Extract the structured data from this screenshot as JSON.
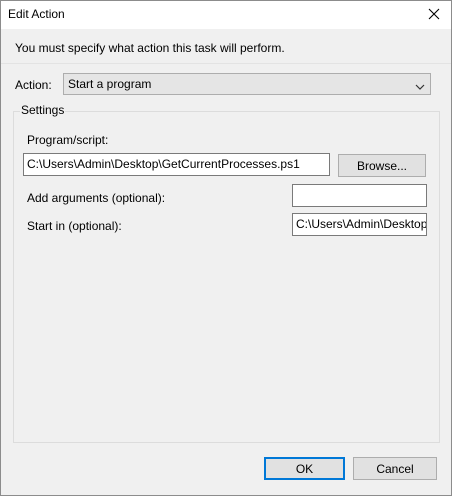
{
  "window": {
    "title": "Edit Action",
    "close_glyph": "✕"
  },
  "instruction": "You must specify what action this task will perform.",
  "action": {
    "label": "Action:",
    "selected": "Start a program"
  },
  "settings": {
    "legend": "Settings",
    "program_label": "Program/script:",
    "program_value": "C:\\Users\\Admin\\Desktop\\GetCurrentProcesses.ps1",
    "browse_label": "Browse...",
    "args_label": "Add arguments (optional):",
    "args_value": "",
    "startin_label": "Start in (optional):",
    "startin_value": "C:\\Users\\Admin\\Desktop"
  },
  "buttons": {
    "ok": "OK",
    "cancel": "Cancel"
  },
  "icons": {
    "close": "close-icon",
    "dropdown": "chevron-down-icon"
  },
  "colors": {
    "window_bg": "#f0f0f0",
    "titlebar_bg": "#ffffff",
    "default_button_border": "#0078d7"
  }
}
